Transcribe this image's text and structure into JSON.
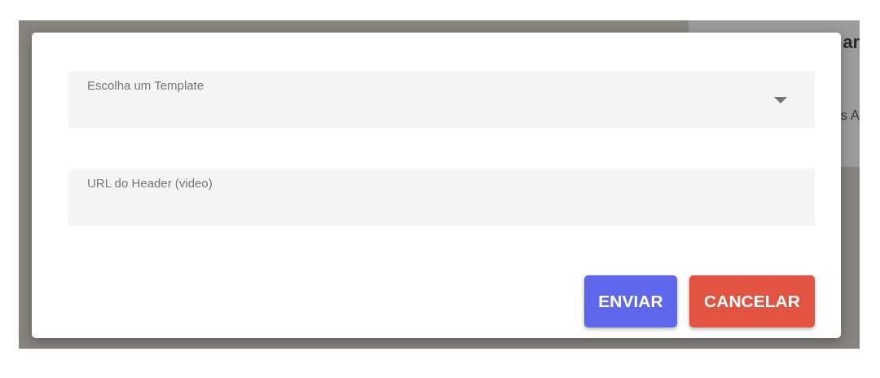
{
  "background": {
    "fragments": [
      "ar",
      "s A"
    ]
  },
  "dialog": {
    "fields": [
      {
        "kind": "select",
        "label": "Escolha um Template"
      },
      {
        "kind": "text",
        "label": "URL do Header (video)"
      }
    ],
    "buttons": [
      {
        "label": "ENVIAR",
        "kind": "primary"
      },
      {
        "label": "CANCELAR",
        "kind": "danger"
      }
    ]
  }
}
